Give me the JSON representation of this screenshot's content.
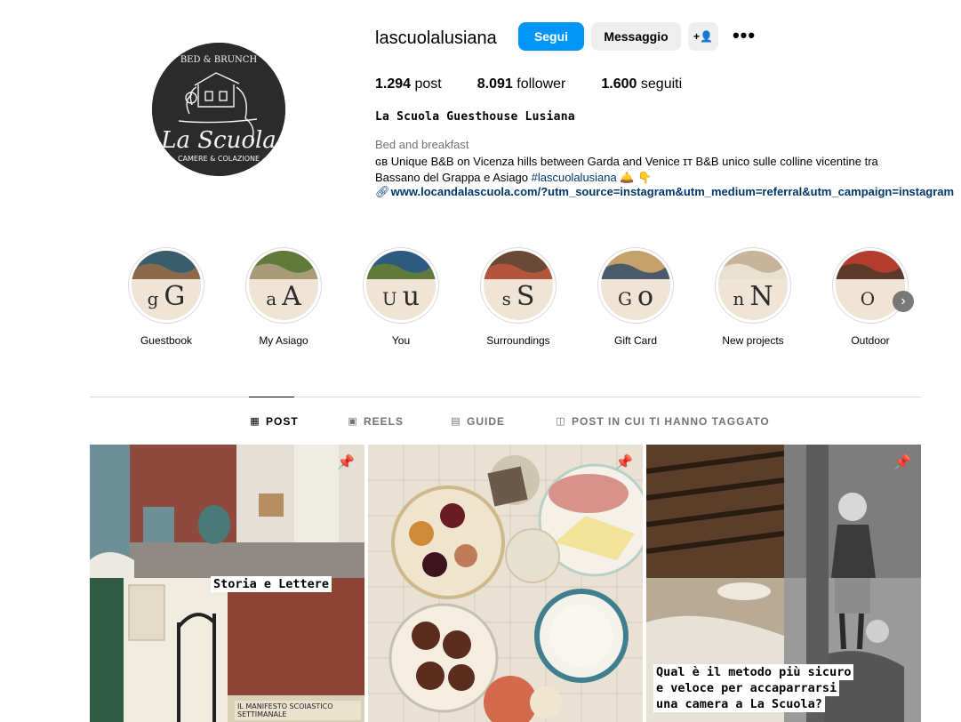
{
  "profile": {
    "username": "lascuolalusiana",
    "follow_label": "Segui",
    "message_label": "Messaggio",
    "add_icon": "person-add-icon",
    "add_glyph": "+👤",
    "more_glyph": "•••",
    "avatar_text_top": "BED & BRUNCH",
    "avatar_text_main": "La Scuola",
    "avatar_text_bottom": "CAMERE & COLAZIONE"
  },
  "stats": {
    "posts_count": "1.294",
    "posts_label": "post",
    "followers_count": "8.091",
    "followers_label": "follower",
    "following_count": "1.600",
    "following_label": "seguiti"
  },
  "bio": {
    "full_name": "La Scuola Guesthouse Lusiana",
    "category": "Bed and breakfast",
    "text_line1": "ɢʙ Unique B&B on Vicenza hills between Garda and Venice ɪᴛ B&B unico sulle colline vicentine tra",
    "text_line2_prefix": "Bassano del Grappa e Asiago ",
    "hashtag": "#lascuolalusiana",
    "emoji": " 🛎️ 👇",
    "link": "www.locandalascuola.com/?utm_source=instagram&utm_medium=referral&utm_campaign=instagram"
  },
  "highlights": [
    {
      "label": "Guestbook",
      "small": "g",
      "big": "G"
    },
    {
      "label": "My Asiago",
      "small": "a",
      "big": "A"
    },
    {
      "label": "You",
      "small": "U",
      "big": "u"
    },
    {
      "label": "Surroundings",
      "small": "s",
      "big": "S"
    },
    {
      "label": "Gift Card",
      "small": "G",
      "big": "o"
    },
    {
      "label": "New projects",
      "small": "n",
      "big": "N"
    },
    {
      "label": "Outdoor",
      "small": "O",
      "big": ""
    }
  ],
  "highlight_next_glyph": "›",
  "tabs": [
    {
      "label": "POST",
      "icon": "grid-icon",
      "glyph": "▦"
    },
    {
      "label": "REELS",
      "icon": "reels-icon",
      "glyph": "▣"
    },
    {
      "label": "GUIDE",
      "icon": "guide-icon",
      "glyph": "▤"
    },
    {
      "label": "POST IN CUI TI HANNO TAGGATO",
      "icon": "tagged-icon",
      "glyph": "◫"
    }
  ],
  "posts": [
    {
      "overlay": "Storia e Lettere",
      "sign": "IL MANIFESTO SCOIASTICO SETTIMANALE",
      "pinned": true
    },
    {
      "pinned": true
    },
    {
      "overlay_lines": [
        "Qual è il metodo più sicuro",
        "e veloce per accaparrarsi",
        "una camera a La Scuola?"
      ],
      "pinned": true
    }
  ],
  "pin_glyph": "📌",
  "colors": {
    "accent": "#0095f6",
    "link": "#00376b",
    "muted": "#737373",
    "button_bg": "#efefef"
  }
}
